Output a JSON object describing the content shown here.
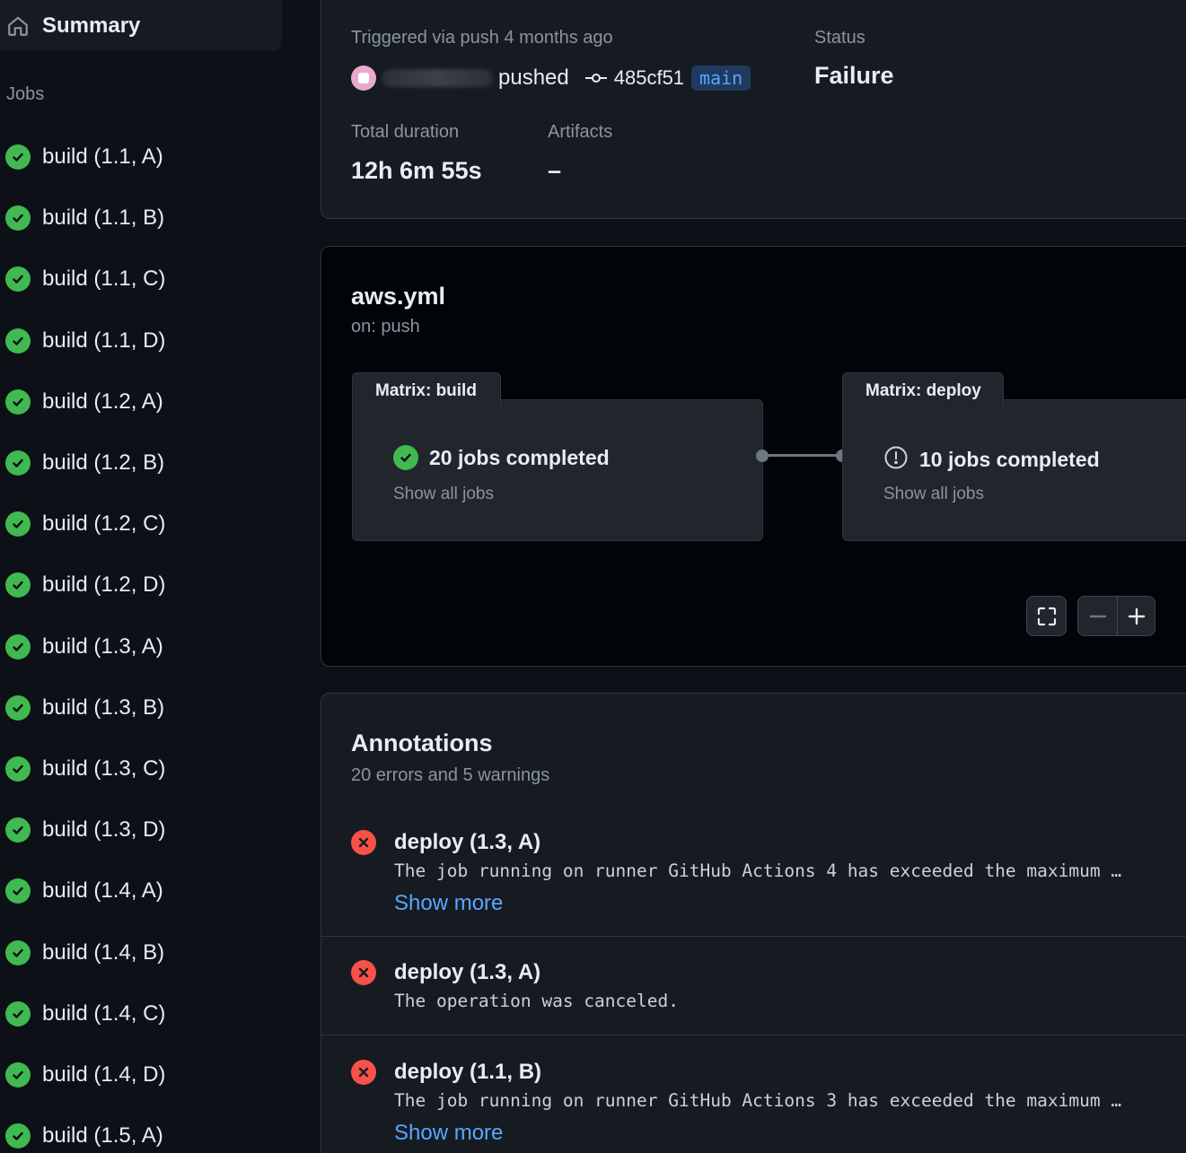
{
  "sidebar": {
    "summary_label": "Summary",
    "jobs_heading": "Jobs",
    "jobs": [
      "build (1.1, A)",
      "build (1.1, B)",
      "build (1.1, C)",
      "build (1.1, D)",
      "build (1.2, A)",
      "build (1.2, B)",
      "build (1.2, C)",
      "build (1.2, D)",
      "build (1.3, A)",
      "build (1.3, B)",
      "build (1.3, C)",
      "build (1.3, D)",
      "build (1.4, A)",
      "build (1.4, B)",
      "build (1.4, C)",
      "build (1.4, D)",
      "build (1.5, A)"
    ]
  },
  "run": {
    "triggered": "Triggered via push 4 months ago",
    "pushed": "pushed",
    "commit": "485cf51",
    "branch": "main",
    "status_label": "Status",
    "status_value": "Failure",
    "duration_label": "Total duration",
    "duration_value": "12h 6m 55s",
    "artifacts_label": "Artifacts",
    "artifacts_value": "–"
  },
  "workflow": {
    "file": "aws.yml",
    "trigger": "on: push",
    "build": {
      "tab": "Matrix: build",
      "status": "20 jobs completed",
      "link": "Show all jobs"
    },
    "deploy": {
      "tab": "Matrix: deploy",
      "status": "10 jobs completed",
      "link": "Show all jobs"
    }
  },
  "annotations": {
    "title": "Annotations",
    "subtitle": "20 errors and 5 warnings",
    "items": [
      {
        "job": "deploy (1.3, A)",
        "message": "The job running on runner GitHub Actions 4 has exceeded the maximum …",
        "more": "Show more"
      },
      {
        "job": "deploy (1.3, A)",
        "message": "The operation was canceled.",
        "more": ""
      },
      {
        "job": "deploy (1.1, B)",
        "message": "The job running on runner GitHub Actions 3 has exceeded the maximum …",
        "more": "Show more"
      }
    ]
  },
  "colors": {
    "success": "#3fb950",
    "danger": "#f85149",
    "accent": "#58a6ff",
    "background": "#0d1117"
  }
}
